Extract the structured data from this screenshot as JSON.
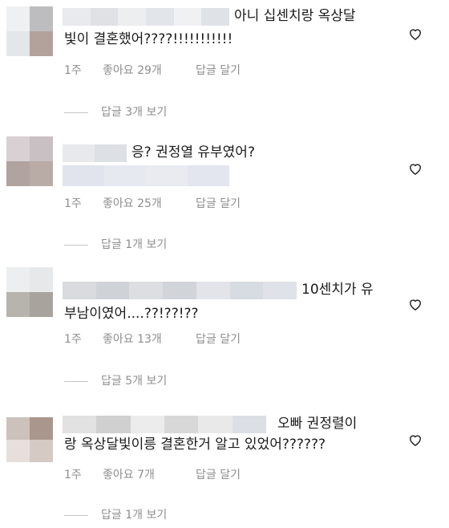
{
  "comments": [
    {
      "line1": "아니 십센치랑 옥상달",
      "line2": "빛이 결혼했어????!!!!!!!!!!!",
      "time": "1주",
      "likes": "좋아요 29개",
      "reply": "답글 달기",
      "view_replies": "답글 3개 보기"
    },
    {
      "line1": "응? 권정열 유부였어?",
      "line2": "",
      "time": "1주",
      "likes": "좋아요 25개",
      "reply": "답글 달기",
      "view_replies": "답글 1개 보기"
    },
    {
      "line1": "10센치가 유",
      "line2": "부남이였어....??!??!??",
      "time": "1주",
      "likes": "좋아요 13개",
      "reply": "답글 달기",
      "view_replies": "답글 5개 보기"
    },
    {
      "line1": "오빠 권정렬이",
      "line2": "랑 옥상달빛이릉 결혼한거 알고 있었어??????",
      "time": "1주",
      "likes": "좋아요 7개",
      "reply": "답글 달기",
      "view_replies": "답글 1개 보기"
    }
  ],
  "icons": {
    "like": "heart-outline-icon"
  },
  "colors": {
    "meta_text": "#8e8e8e",
    "body_text": "#262626"
  }
}
